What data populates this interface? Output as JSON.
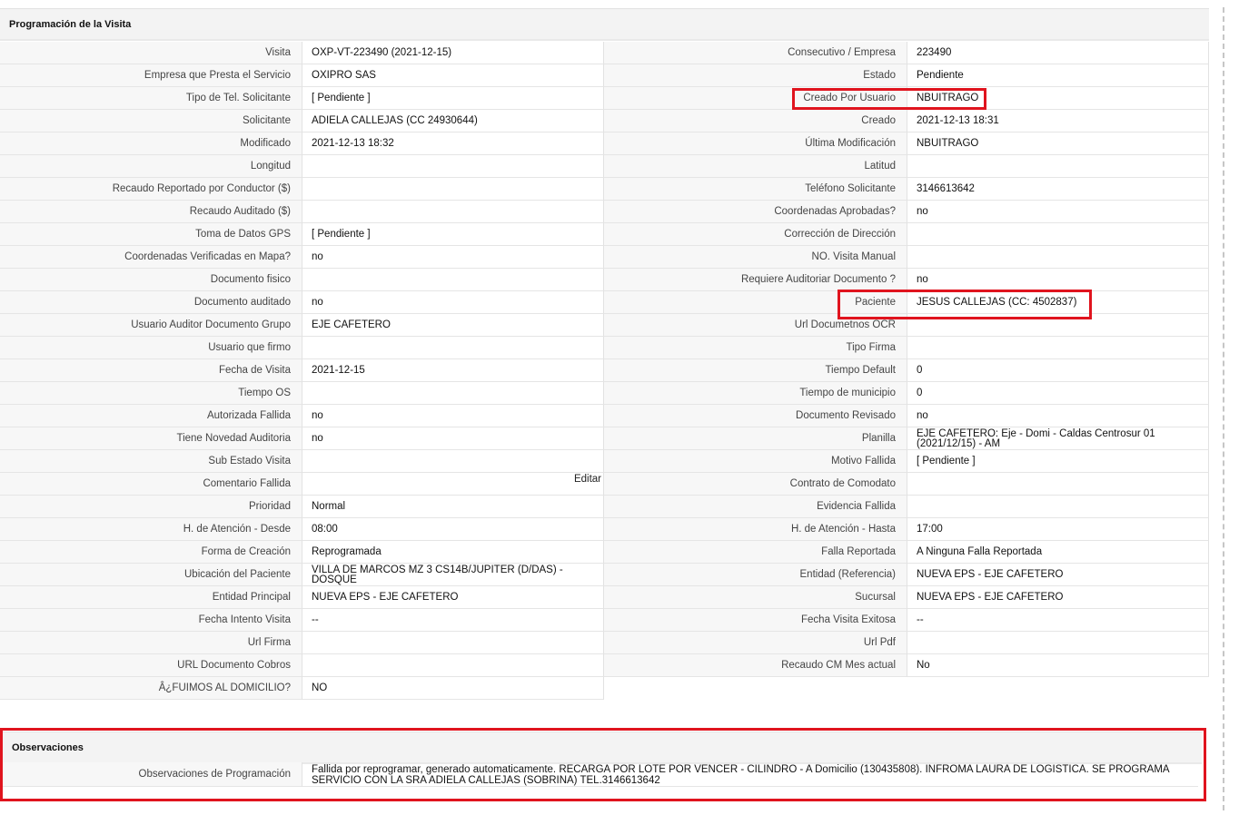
{
  "section_title": "Programación de la Visita",
  "rows": [
    {
      "l1": "Visita",
      "v1": "OXP-VT-223490 (2021-12-15)",
      "l2": "Consecutivo / Empresa",
      "v2": "223490"
    },
    {
      "l1": "Empresa que Presta el Servicio",
      "v1": "OXIPRO SAS",
      "l2": "Estado",
      "v2": "Pendiente"
    },
    {
      "l1": "Tipo de Tel. Solicitante",
      "v1": "[ Pendiente ]",
      "l2": "Creado Por Usuario",
      "v2": "NBUITRAGO"
    },
    {
      "l1": "Solicitante",
      "v1": "ADIELA CALLEJAS (CC 24930644)",
      "l2": "Creado",
      "v2": "2021-12-13 18:31"
    },
    {
      "l1": "Modificado",
      "v1": "2021-12-13 18:32",
      "l2": "Última Modificación",
      "v2": " NBUITRAGO"
    },
    {
      "l1": "Longitud",
      "v1": "",
      "l2": "Latitud",
      "v2": ""
    },
    {
      "l1": "Recaudo Reportado por Conductor ($)",
      "v1": "",
      "l2": "Teléfono Solicitante",
      "v2": "3146613642"
    },
    {
      "l1": "Recaudo Auditado ($)",
      "v1": "",
      "l2": "Coordenadas Aprobadas?",
      "v2": " no"
    },
    {
      "l1": "Toma de Datos GPS",
      "v1": "[ Pendiente ]",
      "l2": "Corrección de Dirección",
      "v2": ""
    },
    {
      "l1": "Coordenadas Verificadas en Mapa?",
      "v1": " no",
      "l2": "NO. Visita Manual",
      "v2": ""
    },
    {
      "l1": "Documento fisico",
      "v1": "",
      "l2": "Requiere Auditoriar Documento ?",
      "v2": " no"
    },
    {
      "l1": "Documento auditado",
      "v1": " no",
      "l2": "Paciente",
      "v2": "JESUS CALLEJAS (CC: 4502837)"
    },
    {
      "l1": "Usuario Auditor Documento Grupo",
      "v1": "EJE CAFETERO",
      "l2": "Url Documetnos OCR",
      "v2": ""
    },
    {
      "l1": "Usuario que firmo",
      "v1": "",
      "l2": "Tipo Firma",
      "v2": ""
    },
    {
      "l1": "Fecha de Visita",
      "v1": " 2021-12-15",
      "l2": "Tiempo Default",
      "v2": "0"
    },
    {
      "l1": "Tiempo OS",
      "v1": "",
      "l2": "Tiempo de municipio",
      "v2": "0"
    },
    {
      "l1": "Autorizada Fallida",
      "v1": " no",
      "l2": "Documento Revisado",
      "v2": " no"
    },
    {
      "l1": "Tiene Novedad Auditoria",
      "v1": " no",
      "l2": "Planilla",
      "v2": "EJE CAFETERO: Eje - Domi - Caldas Centrosur 01 (2021/12/15) - AM"
    },
    {
      "l1": "Sub Estado Visita",
      "v1": "",
      "l2": "Motivo Fallida",
      "v2": "[ Pendiente ]"
    },
    {
      "l1": "Comentario Fallida",
      "v1": "",
      "l2": "Contrato de Comodato",
      "v2": ""
    },
    {
      "l1": "Prioridad",
      "v1": "Normal",
      "l2": "Evidencia Fallida",
      "v2": ""
    },
    {
      "l1": "H. de Atención - Desde",
      "v1": "08:00",
      "l2": "H. de Atención - Hasta",
      "v2": "17:00"
    },
    {
      "l1": "Forma de Creación",
      "v1": "Reprogramada",
      "l2": "Falla Reportada",
      "v2": "A Ninguna Falla Reportada"
    },
    {
      "l1": "Ubicación del Paciente",
      "v1": "VILLA DE MARCOS MZ 3 CS14B/JUPITER (D/DAS) - DOSQUE",
      "l2": "Entidad (Referencia)",
      "v2": "NUEVA EPS - EJE CAFETERO"
    },
    {
      "l1": "Entidad Principal",
      "v1": "NUEVA EPS - EJE CAFETERO",
      "l2": "Sucursal",
      "v2": "NUEVA EPS - EJE CAFETERO"
    },
    {
      "l1": "Fecha Intento Visita",
      "v1": " --",
      "l2": "Fecha Visita Exitosa",
      "v2": " --"
    },
    {
      "l1": "Url Firma",
      "v1": "",
      "l2": "Url Pdf",
      "v2": ""
    },
    {
      "l1": "URL Documento Cobros",
      "v1": "",
      "l2": "Recaudo CM Mes actual",
      "v2": "No"
    },
    {
      "l1": "Â¿FUIMOS AL DOMICILIO?",
      "v1": "NO"
    }
  ],
  "edit_label": "Editar",
  "observaciones": {
    "title": "Observaciones",
    "label": "Observaciones de Programación",
    "value": "  Fallida por reprogramar, generado automaticamente. RECARGA POR LOTE POR VENCER - CILINDRO - A Domicilio (130435808). INFROMA LAURA DE LOGISTICA. SE PROGRAMA SERVICIO CON LA SRA ADIELA CALLEJAS (SOBRINA) TEL.3146613642"
  },
  "colors": {
    "highlight": "#e0141e"
  }
}
